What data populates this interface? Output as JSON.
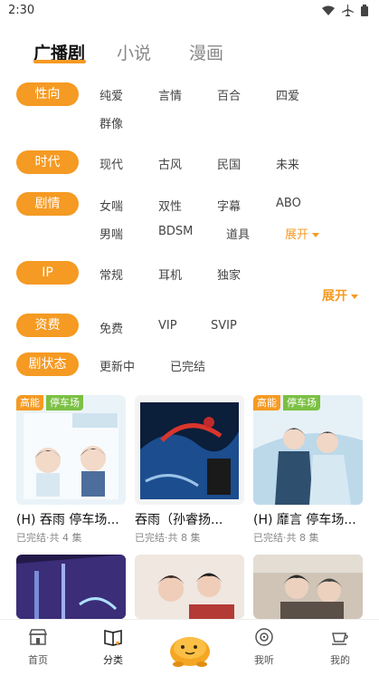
{
  "status": {
    "time": "2:30"
  },
  "tabs": [
    "广播剧",
    "小说",
    "漫画"
  ],
  "filters": {
    "nature": {
      "label": "性向",
      "options": [
        "纯爱",
        "言情",
        "百合",
        "四爱",
        "群像"
      ]
    },
    "era": {
      "label": "时代",
      "options": [
        "现代",
        "古风",
        "民国",
        "未来"
      ]
    },
    "plot": {
      "label": "剧情",
      "options": [
        "女喘",
        "双性",
        "字幕",
        "ABO",
        "男喘",
        "BDSM",
        "道具"
      ],
      "expand": "展开"
    },
    "ip": {
      "label": "IP",
      "options": [
        "常规",
        "耳机",
        "独家"
      ],
      "expand": "展开"
    },
    "fee": {
      "label": "资费",
      "options": [
        "免费",
        "VIP",
        "SVIP"
      ]
    },
    "state": {
      "label": "剧状态",
      "options": [
        "更新中",
        "已完结"
      ]
    }
  },
  "cards": [
    {
      "title": "(H) 吞雨 停车场...",
      "meta": "已完结·共 4 集",
      "badges": [
        "高能",
        "停车场"
      ]
    },
    {
      "title": "吞雨（孙睿扬...",
      "meta": "已完结·共 8 集",
      "badges": []
    },
    {
      "title": "(H) 靡言 停车场...",
      "meta": "已完结·共 8 集",
      "badges": [
        "高能",
        "停车场"
      ]
    }
  ],
  "bottom_nav": [
    "首页",
    "分类",
    "我听",
    "我的"
  ],
  "colors": {
    "accent": "#f59a23",
    "park": "#7bc043"
  }
}
